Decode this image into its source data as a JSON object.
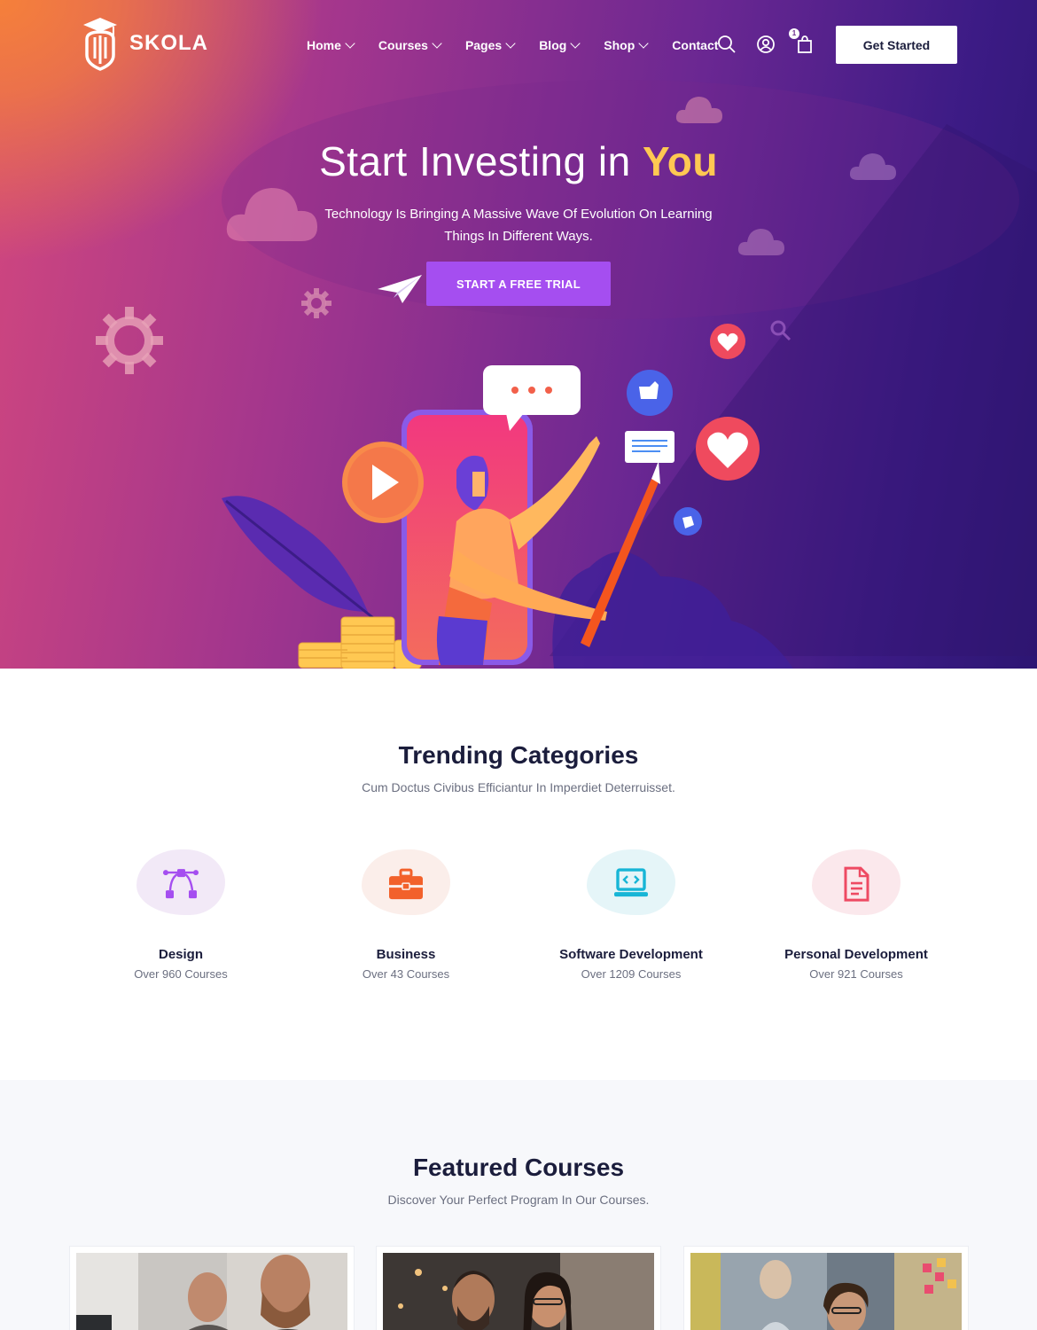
{
  "brand": {
    "name": "SKOLA",
    "logo_icon": "graduation-pencil-logo"
  },
  "nav": {
    "items": [
      {
        "label": "Home",
        "has_dropdown": true
      },
      {
        "label": "Courses",
        "has_dropdown": true
      },
      {
        "label": "Pages",
        "has_dropdown": true
      },
      {
        "label": "Blog",
        "has_dropdown": true
      },
      {
        "label": "Shop",
        "has_dropdown": true
      },
      {
        "label": "Contact",
        "has_dropdown": false
      }
    ],
    "icons": [
      "search-icon",
      "user-icon",
      "cart-icon"
    ],
    "cart_count": "1",
    "cta_label": "Get Started"
  },
  "hero": {
    "title_prefix": "Start Investing in ",
    "title_highlight": "You",
    "subtitle": "Technology Is Bringing A Massive Wave Of Evolution On Learning Things In Different Ways.",
    "cta_label": "START A FREE TRIAL"
  },
  "trending": {
    "title": "Trending Categories",
    "subtitle": "Cum Doctus Civibus Efficiantur In Imperdiet Deterruisset.",
    "categories": [
      {
        "name": "Design",
        "count": "Over 960 Courses",
        "icon": "vector-design-icon",
        "color": "#a54ef0",
        "bg": "#f2e9f7"
      },
      {
        "name": "Business",
        "count": "Over 43 Courses",
        "icon": "briefcase-icon",
        "color": "#f2612b",
        "bg": "#fbeeea"
      },
      {
        "name": "Software Development",
        "count": "Over 1209 Courses",
        "icon": "laptop-code-icon",
        "color": "#17b5d6",
        "bg": "#e5f5f8"
      },
      {
        "name": "Personal Development",
        "count": "Over 921 Courses",
        "icon": "document-icon",
        "color": "#ee4a63",
        "bg": "#fbe8ec"
      }
    ]
  },
  "featured": {
    "title": "Featured Courses",
    "subtitle": "Discover Your Perfect Program In Our Courses."
  },
  "colors": {
    "accent_purple": "#a54ef0",
    "highlight_yellow": "#ffc852",
    "heading_navy": "#1b1d3c"
  }
}
